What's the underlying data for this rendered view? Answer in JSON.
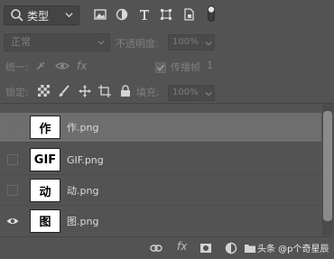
{
  "filter": {
    "label": "类型"
  },
  "blend": {
    "mode": "正常",
    "opacity_label": "不透明度:",
    "opacity_value": "100%"
  },
  "unify": {
    "label": "统一:",
    "propagate_label": "传播帧",
    "propagate_value": "1"
  },
  "lock": {
    "label": "锁定:",
    "fill_label": "填充:",
    "fill_value": "100%"
  },
  "layers": [
    {
      "glyph": "作",
      "name": "作.png",
      "visible": false,
      "selected": true
    },
    {
      "glyph": "GIF",
      "name": "GIF.png",
      "visible": false,
      "selected": false
    },
    {
      "glyph": "动",
      "name": "动.png",
      "visible": false,
      "selected": false
    },
    {
      "glyph": "图",
      "name": "图.png",
      "visible": true,
      "selected": false
    }
  ],
  "watermark": "头条 @p个奇星辰",
  "icons": {
    "filter": [
      "image-filter-icon",
      "adjustment-filter-icon",
      "type-filter-icon",
      "shape-filter-icon",
      "smart-object-filter-icon"
    ],
    "bottom": [
      "link-icon",
      "fx-icon",
      "mask-icon",
      "adjustment-layer-icon",
      "group-icon",
      "new-layer-icon",
      "delete-icon"
    ]
  }
}
